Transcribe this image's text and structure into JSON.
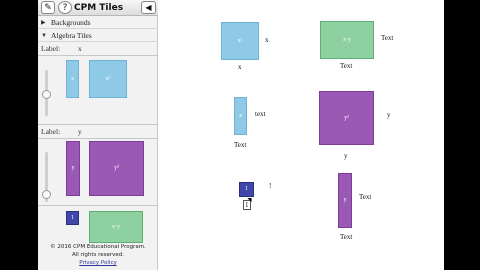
{
  "app": {
    "title": "CPM Tiles",
    "back_icon": "◀"
  },
  "toolbar": {
    "edit_icon": "edit-icon",
    "help_icon": "help-icon"
  },
  "sections": {
    "backgrounds": "Backgrounds",
    "algebra_tiles": "Algebra Tiles"
  },
  "panel": {
    "label1": "Label:",
    "label1_value": "x",
    "label2": "Label:",
    "label2_value": "y",
    "tile_x": "x",
    "tile_x2": "x²",
    "tile_y": "y",
    "tile_y2": "y²",
    "tile_unit": "1",
    "tile_xy": "x·y"
  },
  "footer": {
    "copyright": "© 2016 CPM Educational Program.",
    "rights": "All rights reserved.",
    "privacy": "Privacy Policy"
  },
  "canvas": {
    "tile1": {
      "label": "x²",
      "right": "x",
      "below": "x"
    },
    "tile2": {
      "label": "x·y",
      "right": "Text",
      "below": "Text"
    },
    "tile3": {
      "label": "x",
      "right": "text",
      "below": "Text"
    },
    "tile4": {
      "label": "y²",
      "right": "y",
      "below": "y"
    },
    "tile5": {
      "label": "1",
      "right": "!",
      "below": "1"
    },
    "tile6": {
      "label": "y",
      "right": "Text",
      "below": "Text"
    }
  },
  "colors": {
    "blue": "#8ecae6",
    "purple": "#9b59b6",
    "green": "#8ed0a0",
    "navy": "#3f48a8"
  }
}
